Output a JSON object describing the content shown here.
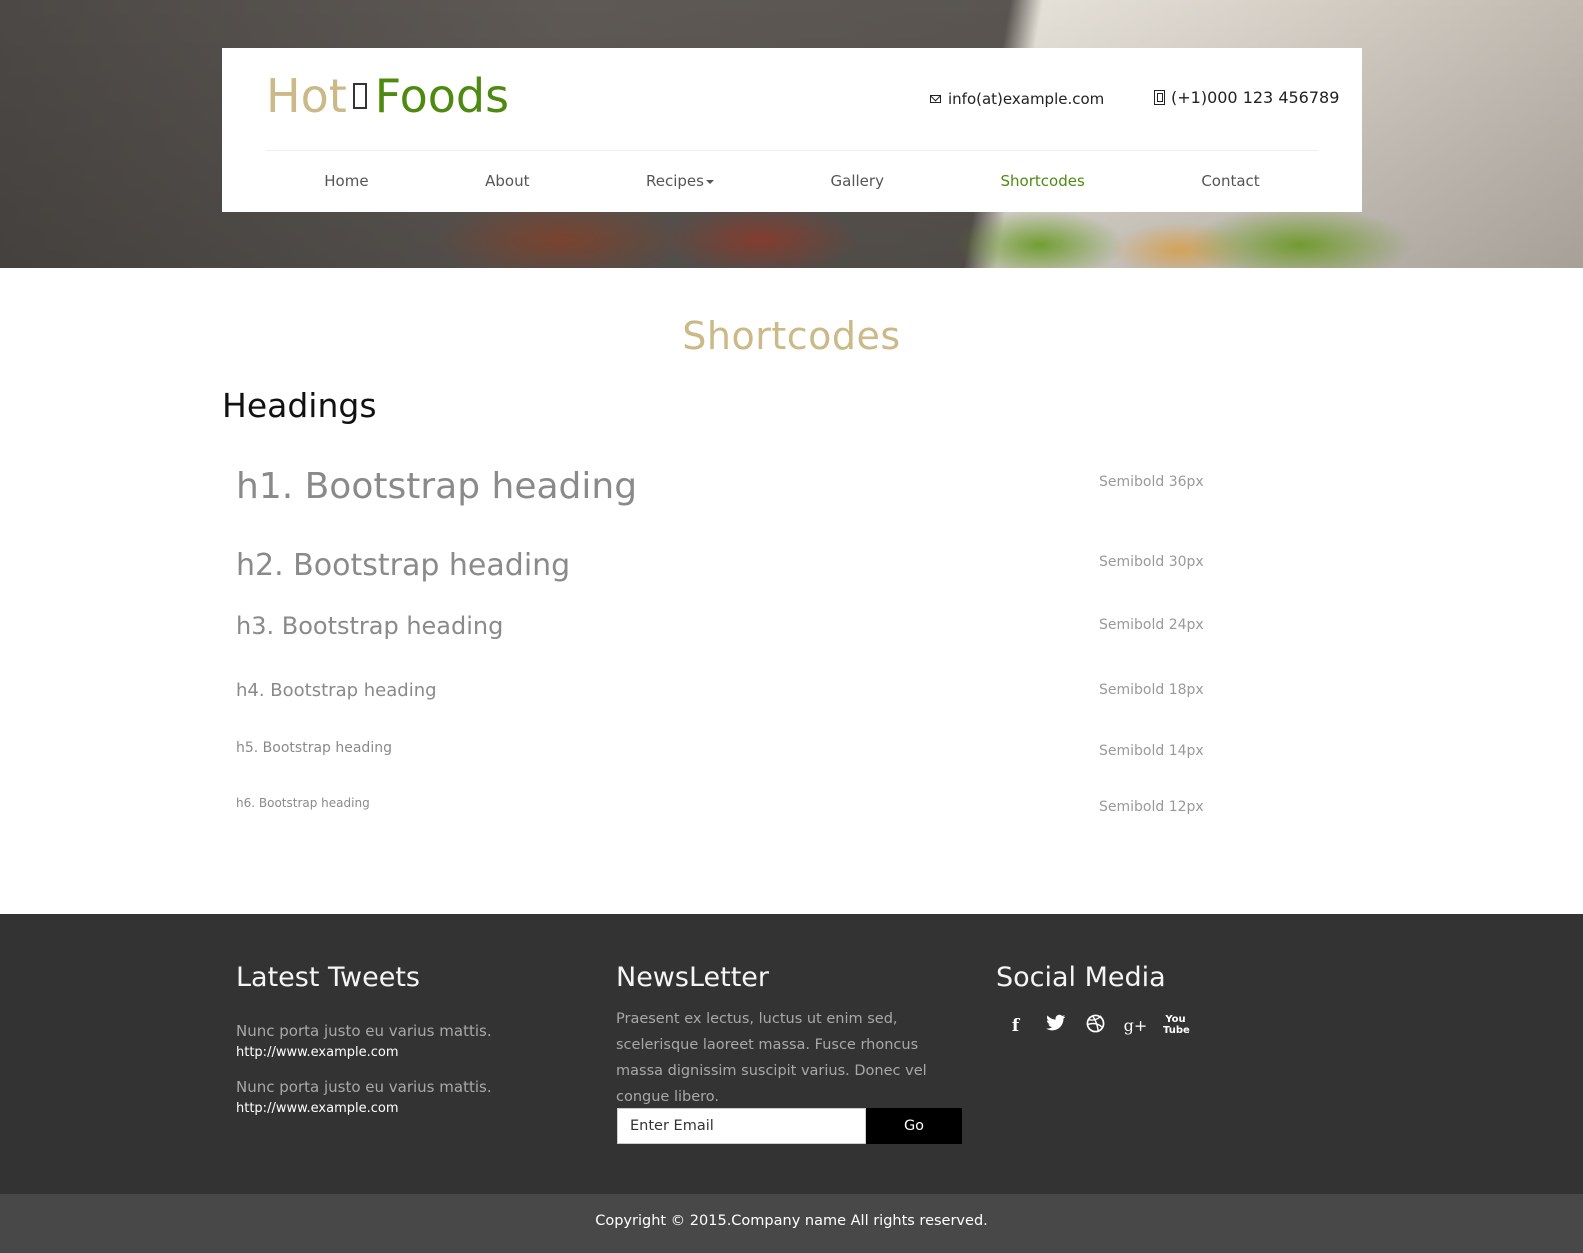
{
  "header": {
    "logo_hot": "Hot",
    "logo_foods": "Foods",
    "email": "info(at)example.com",
    "phone": "(+1)000 123 456789"
  },
  "nav": {
    "items": [
      {
        "label": "Home",
        "active": false
      },
      {
        "label": "About",
        "active": false
      },
      {
        "label": "Recipes",
        "active": false,
        "dropdown": true
      },
      {
        "label": "Gallery",
        "active": false
      },
      {
        "label": "Shortcodes",
        "active": true
      },
      {
        "label": "Contact",
        "active": false
      }
    ]
  },
  "main": {
    "page_title": "Shortcodes",
    "section_title": "Headings",
    "headings": [
      {
        "label": "h1. Bootstrap heading",
        "spec": "Semibold 36px"
      },
      {
        "label": "h2. Bootstrap heading",
        "spec": "Semibold 30px"
      },
      {
        "label": "h3. Bootstrap heading",
        "spec": "Semibold 24px"
      },
      {
        "label": "h4. Bootstrap heading",
        "spec": "Semibold 18px"
      },
      {
        "label": "h5. Bootstrap heading",
        "spec": "Semibold 14px"
      },
      {
        "label": "h6. Bootstrap heading",
        "spec": "Semibold 12px"
      }
    ]
  },
  "footer": {
    "tweets_title": "Latest Tweets",
    "tweets": [
      {
        "text": "Nunc porta justo eu varius mattis.",
        "link": "http://www.example.com"
      },
      {
        "text": "Nunc porta justo eu varius mattis.",
        "link": "http://www.example.com"
      }
    ],
    "newsletter_title": "NewsLetter",
    "newsletter_text": "Praesent ex lectus, luctus ut enim sed, scelerisque laoreet massa. Fusce rhoncus massa dignissim suscipit varius. Donec vel congue libero.",
    "email_placeholder": "Enter Email",
    "go_label": "Go",
    "social_title": "Social Media",
    "social_icons": [
      "facebook-icon",
      "twitter-icon",
      "dribbble-icon",
      "google-plus-icon",
      "youtube-icon"
    ]
  },
  "copyright": "Copyright © 2015.Company name All rights reserved.",
  "colors": {
    "accent_gold": "#cbb987",
    "accent_green": "#4f8a10",
    "footer_bg": "#333333",
    "copyright_bg": "#484848"
  }
}
